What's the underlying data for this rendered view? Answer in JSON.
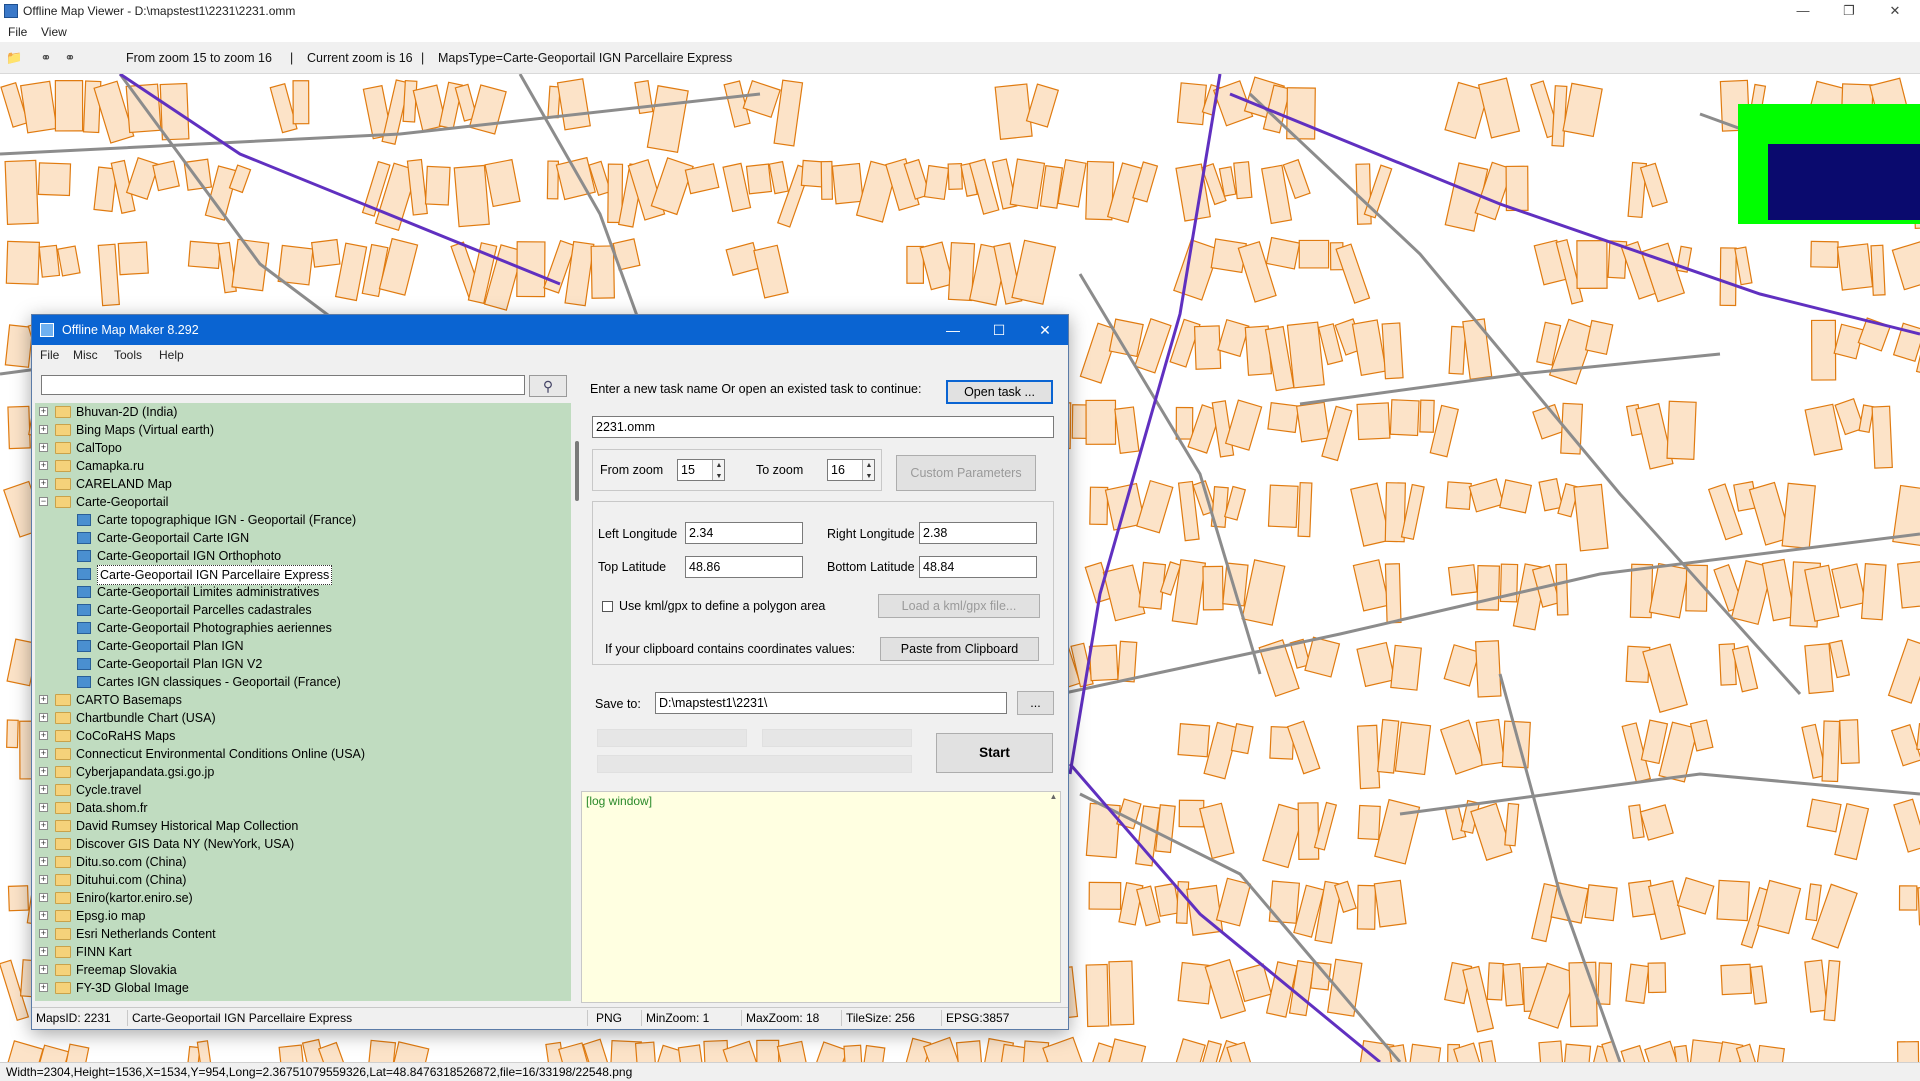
{
  "window": {
    "title": "Offline Map Viewer - D:\\mapstest1\\2231\\2231.omm",
    "menu": [
      "File",
      "View"
    ]
  },
  "toolbar": {
    "zoom_range": "From zoom 15 to zoom 16",
    "current_zoom": "Current zoom is 16",
    "maps_type": "MapsType=Carte-Geoportail IGN Parcellaire Express",
    "sep": "|"
  },
  "statusbar": {
    "text": "Width=2304,Height=1536,X=1534,Y=954,Long=2.36751079559326,Lat=48.8476318526872,file=16/33198/22548.png"
  },
  "map_colors": {
    "parcel_fill": "#fce3c8",
    "parcel_stroke": "#e07b10",
    "road": "#8c8c8c",
    "boundary": "#6030c0",
    "overview_green": "#00ff00",
    "overview_navy": "#0a0a6e"
  },
  "dialog": {
    "title": "Offline Map Maker 8.292",
    "menu": [
      "File",
      "Misc",
      "Tools",
      "Help"
    ],
    "search": {
      "value": ""
    },
    "tree": [
      {
        "label": "Bhuvan-2D (India)",
        "level": 0,
        "type": "folder",
        "expanded": false
      },
      {
        "label": "Bing Maps (Virtual earth)",
        "level": 0,
        "type": "folder",
        "expanded": false
      },
      {
        "label": "CalTopo",
        "level": 0,
        "type": "folder",
        "expanded": false
      },
      {
        "label": "Camapka.ru",
        "level": 0,
        "type": "folder",
        "expanded": false
      },
      {
        "label": "CARELAND Map",
        "level": 0,
        "type": "folder",
        "expanded": false
      },
      {
        "label": "Carte-Geoportail",
        "level": 0,
        "type": "folder",
        "expanded": true
      },
      {
        "label": "Carte topographique IGN - Geoportail (France)",
        "level": 1,
        "type": "map"
      },
      {
        "label": "Carte-Geoportail Carte IGN",
        "level": 1,
        "type": "map"
      },
      {
        "label": "Carte-Geoportail IGN Orthophoto",
        "level": 1,
        "type": "map"
      },
      {
        "label": "Carte-Geoportail IGN Parcellaire Express",
        "level": 1,
        "type": "map",
        "selected": true
      },
      {
        "label": "Carte-Geoportail Limites administratives",
        "level": 1,
        "type": "map"
      },
      {
        "label": "Carte-Geoportail Parcelles cadastrales",
        "level": 1,
        "type": "map"
      },
      {
        "label": "Carte-Geoportail Photographies aeriennes",
        "level": 1,
        "type": "map"
      },
      {
        "label": "Carte-Geoportail Plan IGN",
        "level": 1,
        "type": "map"
      },
      {
        "label": "Carte-Geoportail Plan IGN V2",
        "level": 1,
        "type": "map"
      },
      {
        "label": "Cartes IGN classiques - Geoportail (France)",
        "level": 1,
        "type": "map"
      },
      {
        "label": "CARTO Basemaps",
        "level": 0,
        "type": "folder",
        "expanded": false
      },
      {
        "label": "Chartbundle Chart (USA)",
        "level": 0,
        "type": "folder",
        "expanded": false
      },
      {
        "label": "CoCoRaHS Maps",
        "level": 0,
        "type": "folder",
        "expanded": false
      },
      {
        "label": "Connecticut Environmental Conditions Online (USA)",
        "level": 0,
        "type": "folder",
        "expanded": false
      },
      {
        "label": "Cyberjapandata.gsi.go.jp",
        "level": 0,
        "type": "folder",
        "expanded": false
      },
      {
        "label": "Cycle.travel",
        "level": 0,
        "type": "folder",
        "expanded": false
      },
      {
        "label": "Data.shom.fr",
        "level": 0,
        "type": "folder",
        "expanded": false
      },
      {
        "label": "David Rumsey Historical Map Collection",
        "level": 0,
        "type": "folder",
        "expanded": false
      },
      {
        "label": "Discover GIS Data NY (NewYork, USA)",
        "level": 0,
        "type": "folder",
        "expanded": false
      },
      {
        "label": "Ditu.so.com (China)",
        "level": 0,
        "type": "folder",
        "expanded": false
      },
      {
        "label": "Dituhui.com (China)",
        "level": 0,
        "type": "folder",
        "expanded": false
      },
      {
        "label": "Eniro(kartor.eniro.se)",
        "level": 0,
        "type": "folder",
        "expanded": false
      },
      {
        "label": "Epsg.io map",
        "level": 0,
        "type": "folder",
        "expanded": false
      },
      {
        "label": "Esri Netherlands Content",
        "level": 0,
        "type": "folder",
        "expanded": false
      },
      {
        "label": "FINN Kart",
        "level": 0,
        "type": "folder",
        "expanded": false
      },
      {
        "label": "Freemap Slovakia",
        "level": 0,
        "type": "folder",
        "expanded": false
      },
      {
        "label": "FY-3D Global Image",
        "level": 0,
        "type": "folder",
        "expanded": false
      }
    ],
    "task": {
      "prompt": "Enter a new task name Or open an existed task to continue:",
      "open_button": "Open task ...",
      "name_value": "2231.omm"
    },
    "zoom": {
      "from_label": "From zoom",
      "from_value": "15",
      "to_label": "To zoom",
      "to_value": "16",
      "custom_button": "Custom Parameters"
    },
    "coords": {
      "left_lon_label": "Left Longitude",
      "left_lon": "2.34",
      "right_lon_label": "Right Longitude",
      "right_lon": "2.38",
      "top_lat_label": "Top Latitude",
      "top_lat": "48.86",
      "bottom_lat_label": "Bottom Latitude",
      "bottom_lat": "48.84",
      "kml_label": "Use kml/gpx to define a polygon area",
      "kml_checked": false,
      "kml_button": "Load a kml/gpx file...",
      "clipboard_label": "If your clipboard contains coordinates values:",
      "clipboard_button": "Paste from Clipboard"
    },
    "save": {
      "label": "Save to:",
      "path": "D:\\mapstest1\\2231\\",
      "browse": "..."
    },
    "start_button": "Start",
    "log_text": "[log window]",
    "status": {
      "maps_id": "MapsID: 2231",
      "maps_name": "Carte-Geoportail IGN Parcellaire Express",
      "format": "PNG",
      "min_zoom": "MinZoom: 1",
      "max_zoom": "MaxZoom: 18",
      "tile_size": "TileSize: 256",
      "epsg": "EPSG:3857"
    }
  }
}
